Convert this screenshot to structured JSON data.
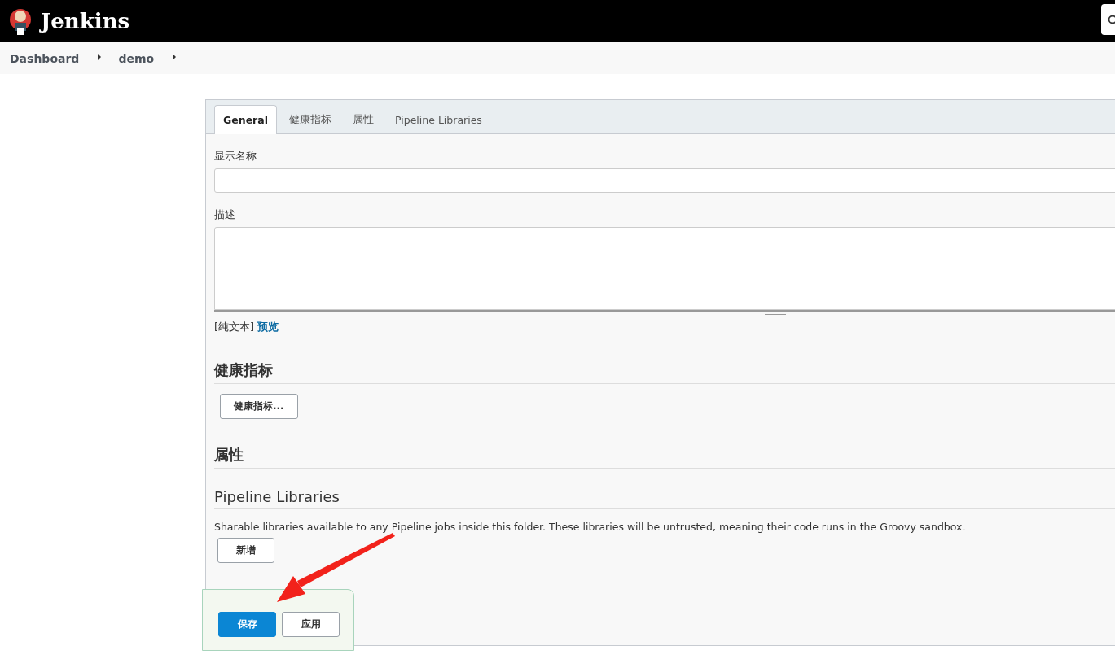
{
  "header": {
    "title": "Jenkins"
  },
  "breadcrumbs": [
    "Dashboard",
    "demo"
  ],
  "tabs": [
    {
      "label": "General",
      "selected": true
    },
    {
      "label": "健康指标",
      "selected": false
    },
    {
      "label": "属性",
      "selected": false
    },
    {
      "label": "Pipeline Libraries",
      "selected": false
    }
  ],
  "fields": [
    {
      "label": "显示名称",
      "kind": "input"
    },
    {
      "label": "描述",
      "kind": "textarea"
    }
  ],
  "format": {
    "text": "[纯文本]",
    "link": "预览"
  },
  "sections": [
    {
      "title": "健康指标",
      "button": "健康指标..."
    },
    {
      "title": "属性"
    },
    {
      "title": "Pipeline Libraries",
      "description": "Sharable libraries available to any Pipeline jobs inside this folder. These libraries will be untrusted, meaning their code runs in the Groovy sandbox.",
      "button": "新增"
    }
  ],
  "actions": [
    {
      "label": "保存",
      "kind": "primary"
    },
    {
      "label": "应用",
      "kind": "secondary"
    }
  ]
}
